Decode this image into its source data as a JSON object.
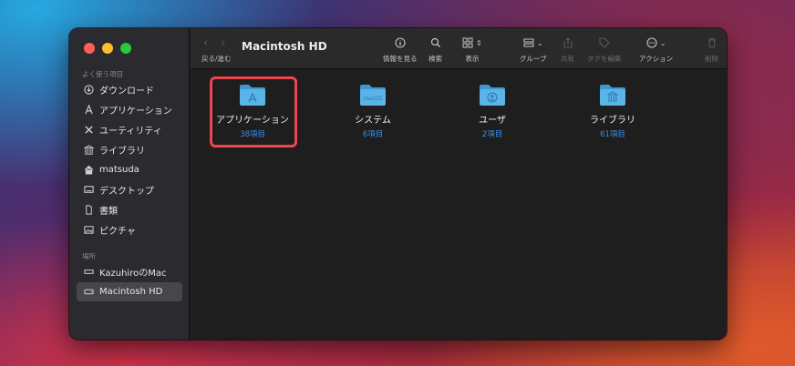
{
  "window": {
    "title": "Macintosh HD",
    "nav_label": "戻る/進む"
  },
  "sidebar": {
    "favorites_label": "よく使う項目",
    "favorites": [
      {
        "label": "ダウンロード",
        "icon": "download-icon"
      },
      {
        "label": "アプリケーション",
        "icon": "applications-icon"
      },
      {
        "label": "ユーティリティ",
        "icon": "utilities-icon"
      },
      {
        "label": "ライブラリ",
        "icon": "library-icon"
      },
      {
        "label": "matsuda",
        "icon": "home-icon"
      },
      {
        "label": "デスクトップ",
        "icon": "desktop-icon"
      },
      {
        "label": "書類",
        "icon": "document-icon"
      },
      {
        "label": "ピクチャ",
        "icon": "pictures-icon"
      }
    ],
    "locations_label": "場所",
    "locations": [
      {
        "label": "KazuhiroのMac",
        "icon": "computer-icon"
      },
      {
        "label": "Macintosh HD",
        "icon": "disk-icon",
        "selected": true
      }
    ]
  },
  "toolbar": {
    "info": "情報を見る",
    "search": "検索",
    "view": "表示",
    "group": "グループ",
    "share": "共有",
    "tags": "タグを編集",
    "action": "アクション",
    "delete": "削除"
  },
  "items": [
    {
      "name": "アプリケーション",
      "count": "38項目",
      "icon": "applications-folder-icon",
      "highlighted": true
    },
    {
      "name": "システム",
      "count": "6項目",
      "icon": "system-folder-icon",
      "badge": "macOS"
    },
    {
      "name": "ユーザ",
      "count": "2項目",
      "icon": "users-folder-icon"
    },
    {
      "name": "ライブラリ",
      "count": "61項目",
      "icon": "library-folder-icon"
    }
  ],
  "colors": {
    "folder": "#5ab4e8",
    "folder_dark": "#3f97cf",
    "accent_count": "#3a8ee6",
    "highlight": "#ef4550"
  }
}
